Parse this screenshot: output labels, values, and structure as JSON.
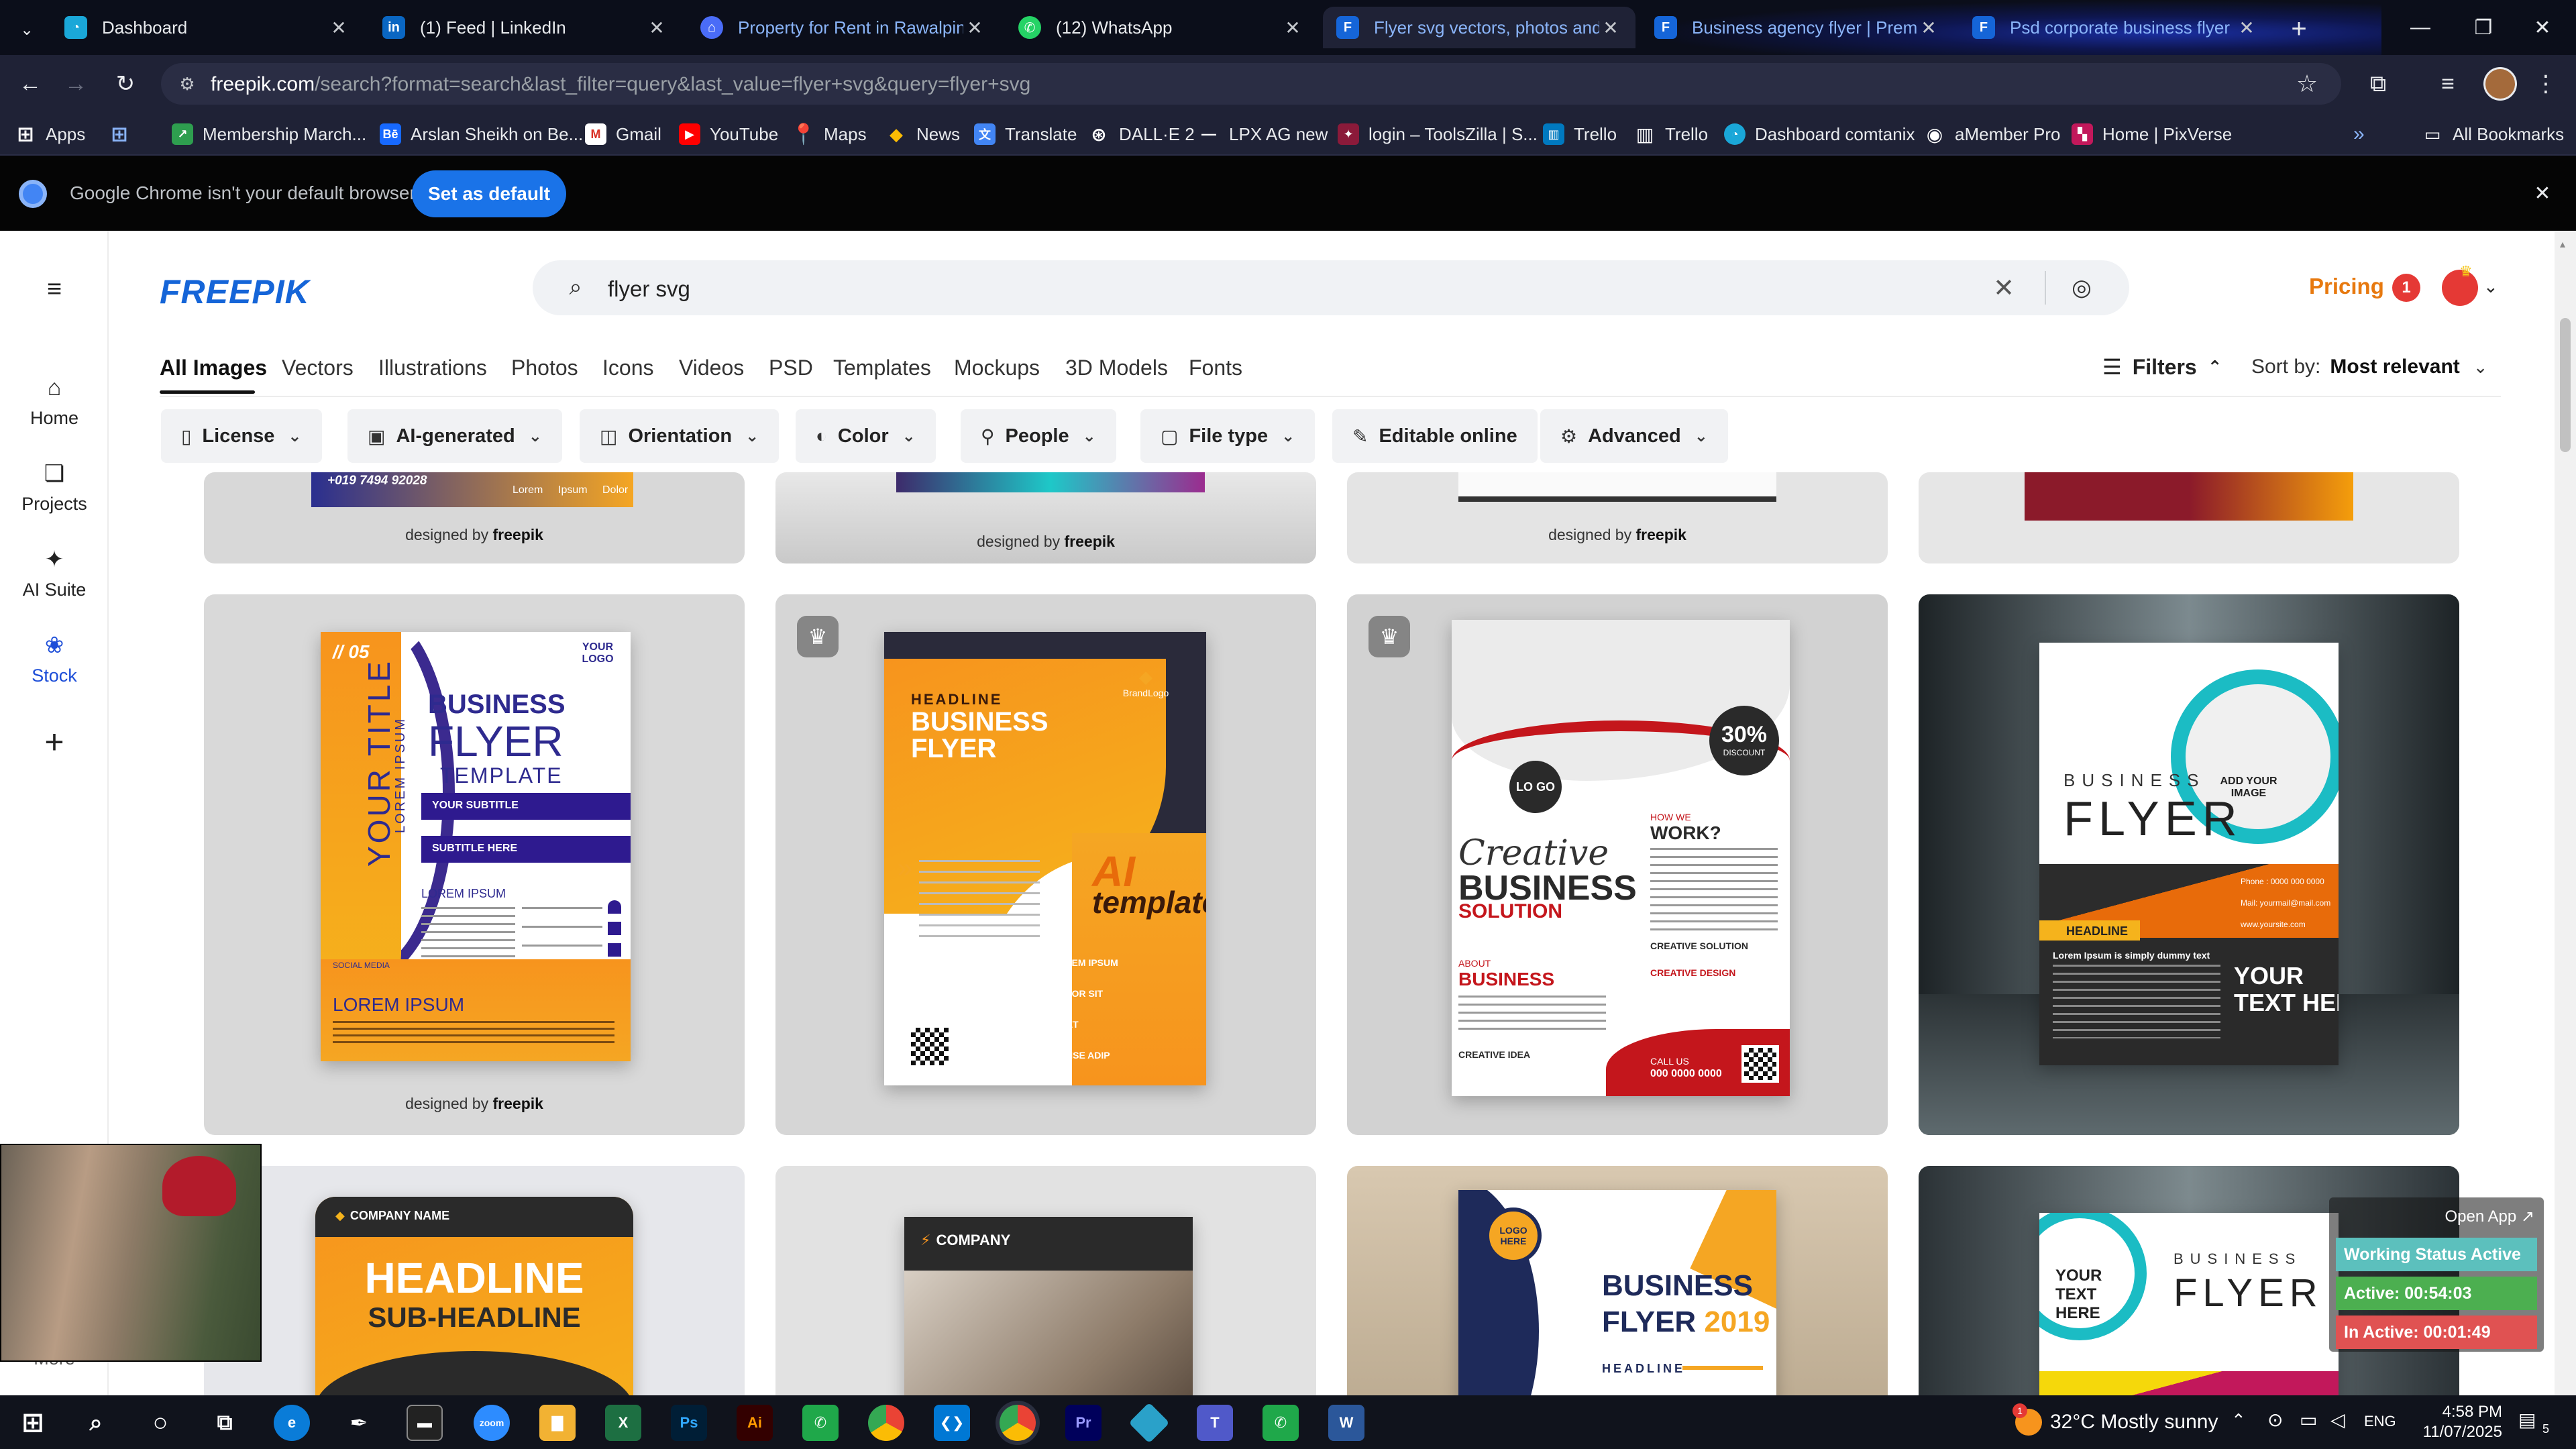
{
  "browser": {
    "tabs": [
      {
        "title": "Dashboard",
        "favicon": "gauge-icon",
        "color": "#1aa7d8"
      },
      {
        "title": "(1) Feed | LinkedIn",
        "favicon": "linkedin-icon",
        "color": "#0a66c2"
      },
      {
        "title": "Property for Rent in Rawalpindi",
        "favicon": "house-icon",
        "color": "#4a6cf7"
      },
      {
        "title": "(12) WhatsApp",
        "favicon": "whatsapp-icon",
        "color": "#25d366"
      },
      {
        "title": "Flyer svg vectors, photos and P",
        "favicon": "freepik-icon",
        "color": "#1565d8"
      },
      {
        "title": "Business agency flyer | Premium",
        "favicon": "freepik-icon",
        "color": "#1565d8"
      },
      {
        "title": "Psd corporate business flyer de",
        "favicon": "freepik-icon",
        "color": "#1565d8"
      }
    ],
    "url_host": "freepik.com",
    "url_path": "/search?format=search&last_filter=query&last_value=flyer+svg&query=flyer+svg",
    "bookmarks": [
      {
        "label": "Apps",
        "icon": "grid-icon"
      },
      {
        "label": "Membership March...",
        "icon": "bookmark-icon"
      },
      {
        "label": "Arslan Sheikh on Be...",
        "icon": "behance-icon"
      },
      {
        "label": "Gmail",
        "icon": "gmail-icon"
      },
      {
        "label": "YouTube",
        "icon": "youtube-icon"
      },
      {
        "label": "Maps",
        "icon": "maps-icon"
      },
      {
        "label": "News",
        "icon": "news-icon"
      },
      {
        "label": "Translate",
        "icon": "translate-icon"
      },
      {
        "label": "DALL·E 2",
        "icon": "openai-icon"
      },
      {
        "label": "LPX AG new",
        "icon": "dash-icon"
      },
      {
        "label": "login – ToolsZilla | S...",
        "icon": "tools-icon"
      },
      {
        "label": "Trello",
        "icon": "trello-icon"
      },
      {
        "label": "Trello",
        "icon": "trello-icon"
      },
      {
        "label": "Dashboard comtanix",
        "icon": "gauge-icon"
      },
      {
        "label": "aMember Pro",
        "icon": "member-icon"
      },
      {
        "label": "Home | PixVerse",
        "icon": "pixverse-icon"
      }
    ],
    "all_bookmarks": "All Bookmarks",
    "default_msg": "Google Chrome isn't your default browser",
    "set_default": "Set as default"
  },
  "freepik": {
    "logo": "FREEPIK",
    "search_query": "flyer svg",
    "pricing": "Pricing",
    "notification_count": "1",
    "nav": [
      {
        "label": "Home",
        "icon": "home-icon"
      },
      {
        "label": "Projects",
        "icon": "projects-icon"
      },
      {
        "label": "AI Suite",
        "icon": "sparkle-icon"
      },
      {
        "label": "Stock",
        "icon": "stock-icon"
      },
      {
        "label": "",
        "icon": "plus-icon"
      }
    ],
    "nav_more": "More",
    "content_tabs": [
      "All Images",
      "Vectors",
      "Illustrations",
      "Photos",
      "Icons",
      "Videos",
      "PSD",
      "Templates",
      "Mockups",
      "3D Models",
      "Fonts"
    ],
    "filters_label": "Filters",
    "sort_label": "Sort by:",
    "sort_value": "Most relevant",
    "chips": [
      "License",
      "AI-generated",
      "Orientation",
      "Color",
      "People",
      "File type",
      "Editable online",
      "Advanced"
    ],
    "designed_by": "designed by",
    "designed_brand": "freepik"
  },
  "flyers": {
    "f1": {
      "number": "// 05",
      "logo": "YOUR LOGO",
      "title": "BUSINESS",
      "title2": "FLYER",
      "title3": "TEMPLATE",
      "side": "YOUR TITLE",
      "side2": "LOREM IPSUM",
      "sub1": "YOUR SUBTITLE",
      "sub2": "SUBTITLE HERE",
      "small": "LOREM IPSUM",
      "bottom": "LOREM IPSUM",
      "social": "SOCIAL MEDIA",
      "phone": "+019 7494 92028",
      "icon_labels": [
        "Lorem",
        "Ipsum",
        "Dolor"
      ]
    },
    "f2": {
      "headline": "HEADLINE",
      "title": "BUSINESS",
      "title2": "FLYER",
      "brand": "BrandLogo",
      "ai": "AI",
      "template": "template",
      "b1": "LOREM IPSUM",
      "b2": "DOLOR SIT",
      "b3": "AMET",
      "b4": "CONSE ADIP"
    },
    "f3": {
      "logo": "LO GO",
      "discount": "30%",
      "discount_label": "DISCOUNT",
      "creative": "Creative",
      "business": "BUSINESS",
      "solution": "SOLUTION",
      "how": "HOW WE",
      "work": "WORK?",
      "about": "ABOUT",
      "about2": "BUSINESS",
      "cs": "CREATIVE SOLUTION",
      "cd": "CREATIVE DESIGN",
      "ci": "CREATIVE IDEA",
      "call": "CALL US",
      "phone": "000 0000 0000"
    },
    "f4": {
      "business": "BUSINESS",
      "flyer": "FLYER",
      "add": "ADD YOUR IMAGE",
      "headline": "HEADLINE",
      "lorem": "Lorem Ipsum is simply dummy text",
      "your": "YOUR",
      "text": "TEXT HERE",
      "phone": "Phone : 0000 000 0000",
      "mail": "Mail: yourmail@mail.com",
      "web": "www.yoursite.com"
    },
    "f5": {
      "company": "COMPANY NAME",
      "headline": "HEADLINE",
      "sub": "SUB-HEADLINE"
    },
    "f6": {
      "company": "COMPANY"
    },
    "f7": {
      "logo": "LOGO HERE",
      "business": "BUSINESS",
      "flyer": "FLYER",
      "year": "2019",
      "headline": "HEADLINE"
    },
    "f8": {
      "your": "YOUR TEXT HERE",
      "business": "BUSINESS",
      "flyer": "FLYER"
    }
  },
  "tracker": {
    "open": "Open App ↗",
    "status": "Working Status Active",
    "active": "Active: 00:54:03",
    "inactive": "In Active: 00:01:49"
  },
  "taskbar": {
    "weather_temp": "32°C",
    "weather_desc": "Mostly sunny",
    "lang": "ENG",
    "time": "4:58 PM",
    "date": "11/07/2025",
    "notif_count": "5",
    "weather_badge": "1"
  },
  "colors": {
    "freepik_blue": "#1565d8",
    "pricing_orange": "#e7790f",
    "chrome_bg": "#1f2236",
    "tracker_green": "#4caf50",
    "tracker_red": "#e05252",
    "tracker_teal": "#5cc0bd"
  }
}
